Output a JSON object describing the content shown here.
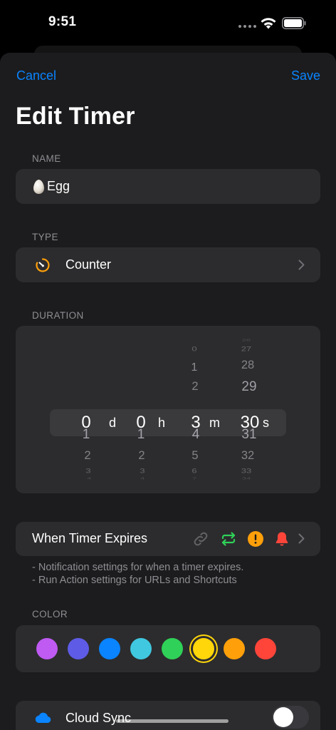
{
  "status": {
    "time": "9:51"
  },
  "nav": {
    "cancel": "Cancel",
    "save": "Save",
    "title": "Edit Timer"
  },
  "name_section": {
    "label": "NAME",
    "value": "Egg",
    "icon": "egg-icon"
  },
  "type_section": {
    "label": "TYPE",
    "value": "Counter",
    "icon": "timer-icon"
  },
  "duration_section": {
    "label": "DURATION",
    "days": {
      "above": [
        "",
        "",
        "",
        ""
      ],
      "selected": "0",
      "below": [
        "1",
        "2",
        "3",
        "4"
      ],
      "unit": "d"
    },
    "hours": {
      "above": [
        "",
        "",
        "",
        ""
      ],
      "selected": "0",
      "below": [
        "1",
        "2",
        "3",
        "4"
      ],
      "unit": "h"
    },
    "minutes": {
      "above": [
        "2",
        "1",
        "0",
        ""
      ],
      "selected": "3",
      "below": [
        "4",
        "5",
        "6",
        "7"
      ],
      "unit": "m"
    },
    "seconds": {
      "above": [
        "29",
        "28",
        "27",
        "26"
      ],
      "selected": "30",
      "below": [
        "31",
        "32",
        "33",
        "34"
      ],
      "unit": "s"
    }
  },
  "expires": {
    "label": "When Timer Expires",
    "icons": [
      "link-icon",
      "repeat-icon",
      "alert-icon",
      "bell-icon"
    ],
    "note_1": "- Notification settings for when a timer expires.",
    "note_2": "- Run Action settings for URLs and Shortcuts"
  },
  "color_section": {
    "label": "COLOR",
    "swatches": [
      "#bf5af2",
      "#5e5ce6",
      "#0a84ff",
      "#40c8e0",
      "#30d158",
      "#ffd60a",
      "#ff9f0a",
      "#ff453a"
    ],
    "selected": "#ffd60a"
  },
  "sync": {
    "label": "Cloud Sync",
    "enabled": false
  },
  "colors": {
    "accent": "#0a84ff",
    "background": "#1c1c1e",
    "card": "#2c2c2e",
    "secondary": "#8e8e93"
  }
}
